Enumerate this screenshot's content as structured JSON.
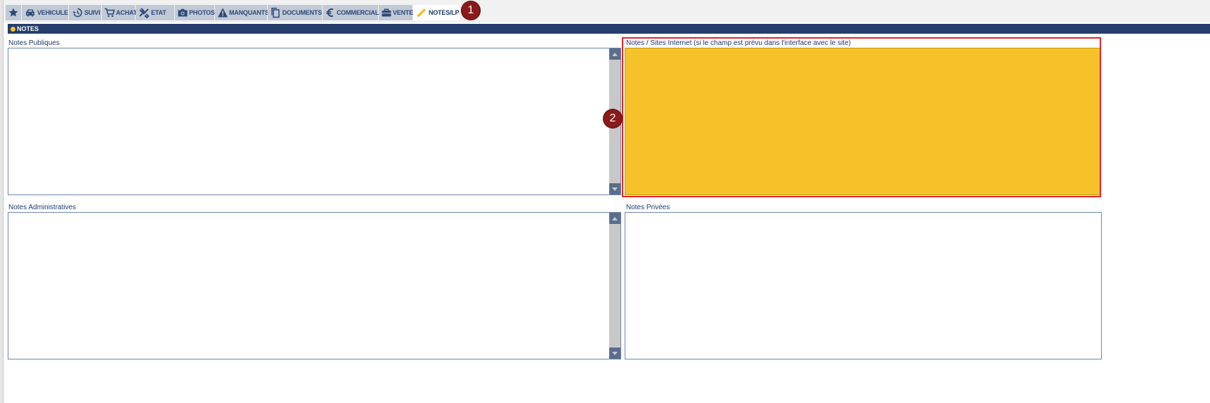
{
  "tabs": [
    {
      "label": "",
      "icon": "star-icon"
    },
    {
      "label": "VEHICULE",
      "icon": "car-icon"
    },
    {
      "label": "SUIVI",
      "icon": "history-icon"
    },
    {
      "label": "ACHAT",
      "icon": "cart-icon"
    },
    {
      "label": "ETAT",
      "icon": "tools-icon"
    },
    {
      "label": "PHOTOS",
      "icon": "camera-icon"
    },
    {
      "label": "MANQUANTS",
      "icon": "warning-icon"
    },
    {
      "label": "DOCUMENTS",
      "icon": "documents-icon"
    },
    {
      "label": "COMMERCIAL",
      "icon": "euro-icon"
    },
    {
      "label": "VENTE",
      "icon": "briefcase-icon"
    },
    {
      "label": "NOTES/LP",
      "icon": "pencil-icon",
      "active": true
    }
  ],
  "badges": [
    "1",
    "2"
  ],
  "section": {
    "title": "NOTES"
  },
  "notes": {
    "public": {
      "label": "Notes Publiques",
      "value": ""
    },
    "internet": {
      "label": "Notes / Sites Internet (si le champ est prévu dans l'interface avec le site)",
      "value": "",
      "bg_color": "#f5c22a"
    },
    "admin": {
      "label": "Notes Administratives",
      "value": ""
    },
    "private": {
      "label": "Notes Privées",
      "value": ""
    }
  },
  "colors": {
    "header": "#253e6b",
    "tab_bg": "#c2cad6",
    "tab_text": "#2b4a7a",
    "badge": "#8b1a1a",
    "highlight": "#e0252b"
  }
}
